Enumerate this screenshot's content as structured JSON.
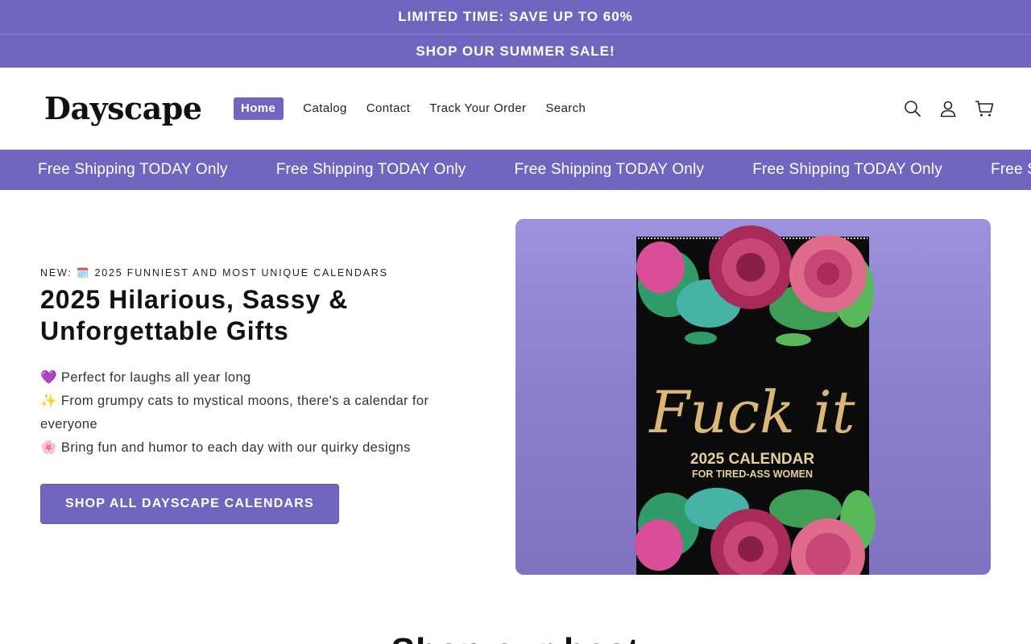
{
  "announcements": [
    "LIMITED TIME: SAVE UP TO 60%",
    "SHOP OUR SUMMER SALE!"
  ],
  "header": {
    "logo": "Dayscape",
    "nav": [
      {
        "label": "Home",
        "active": true
      },
      {
        "label": "Catalog"
      },
      {
        "label": "Contact"
      },
      {
        "label": "Track Your Order"
      },
      {
        "label": "Search"
      }
    ],
    "icons": [
      "search-icon",
      "account-icon",
      "cart-icon"
    ]
  },
  "marquee": {
    "items": [
      "Free Shipping TODAY Only",
      "Free Shipping TODAY Only",
      "Free Shipping TODAY Only",
      "Free Shipping TODAY Only",
      "Free Shipping TODAY Only"
    ]
  },
  "hero": {
    "eyebrow": "NEW: 🗓️ 2025 FUNNIEST AND MOST UNIQUE CALENDARS",
    "title": "2025 Hilarious, Sassy & Unforgettable Gifts",
    "bullets": [
      "💜 Perfect for laughs all year long",
      "✨ From grumpy cats to mystical moons, there's a calendar for everyone",
      "🌸 Bring fun and humor to each day with our quirky designs"
    ],
    "cta_label": "SHOP ALL DAYSCAPE CALENDARS",
    "product": {
      "script_text": "Fuck it",
      "line1": "2025 CALENDAR",
      "line2": "FOR TIRED-ASS WOMEN"
    }
  },
  "next_section_heading": "Shop our best",
  "colors": {
    "brand": "#7066bf",
    "calendar_bg": "#0b0b0b",
    "gold": "#d9b877"
  }
}
